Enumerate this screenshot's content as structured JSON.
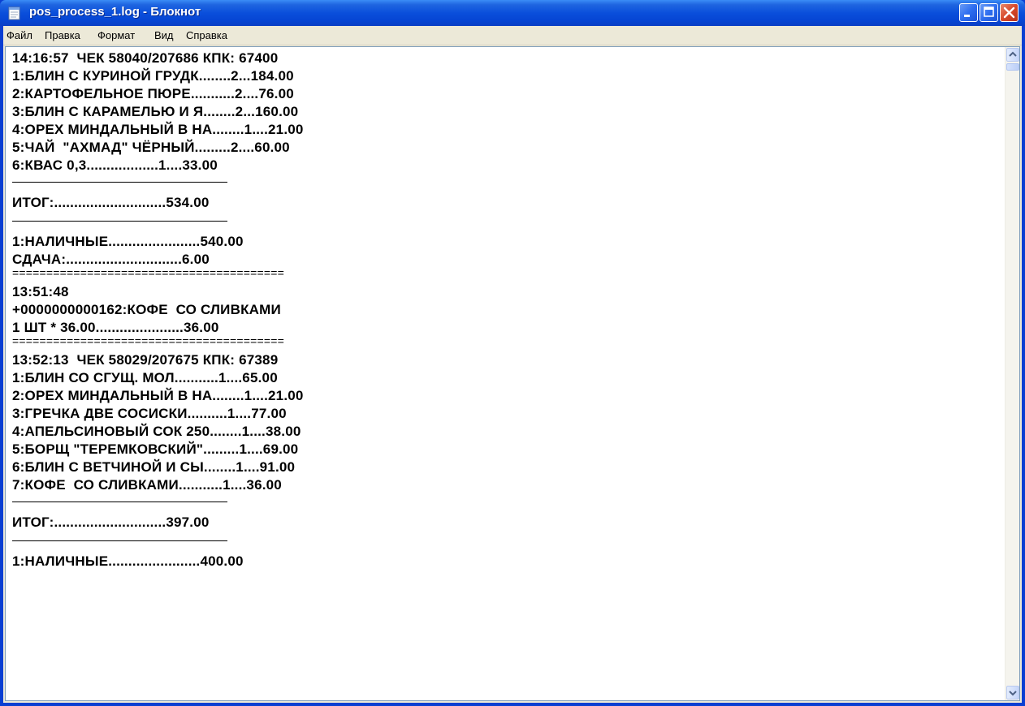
{
  "window": {
    "title": "pos_process_1.log - Блокнот",
    "icon": "notepad-icon",
    "buttons": [
      "minimize-icon",
      "maximize-icon",
      "close-icon"
    ]
  },
  "menu": {
    "items": [
      {
        "label": "Файл"
      },
      {
        "label": "Правка"
      },
      {
        "label": "Формат"
      },
      {
        "label": "Вид"
      },
      {
        "label": "Справка"
      }
    ]
  },
  "document": {
    "lines": [
      "14:16:57  ЧЕК 58040/207686 КПК: 67400",
      "1:БЛИН С КУРИНОЙ ГРУДК........2...184.00",
      "2:КАРТОФЕЛЬНОЕ ПЮРЕ...........2....76.00",
      "3:БЛИН С КАРАМЕЛЬЮ И Я........2...160.00",
      "4:ОРЕХ МИНДАЛЬНЫЙ В НА........1....21.00",
      "5:ЧАЙ  \"АХМАД\" ЧЁРНЫЙ.........2....60.00",
      "6:КВАС 0,3..................1....33.00",
      "ИТОГ:............................534.00",
      "1:НАЛИЧНЫЕ.......................540.00",
      "СДАЧА:.............................6.00",
      "========================================",
      "13:51:48",
      "+0000000000162:КОФЕ  СО СЛИВКАМИ",
      "1 ШТ * 36.00......................36.00",
      "========================================",
      "13:52:13  ЧЕК 58029/207675 КПК: 67389",
      "1:БЛИН СО СГУЩ. МОЛ...........1....65.00",
      "2:ОРЕХ МИНДАЛЬНЫЙ В НА........1....21.00",
      "3:ГРЕЧКА ДВЕ СОСИСКИ..........1....77.00",
      "4:АПЕЛЬСИНОВЫЙ СОК 250........1....38.00",
      "5:БОРЩ \"ТЕРЕМКОВСКИЙ\".........1....69.00",
      "6:БЛИН С ВЕТЧИНОЙ И СЫ........1....91.00",
      "7:КОФЕ  СО СЛИВКАМИ...........1....36.00",
      "ИТОГ:............................397.00",
      "1:НАЛИЧНЫЕ.......................400.00"
    ]
  }
}
